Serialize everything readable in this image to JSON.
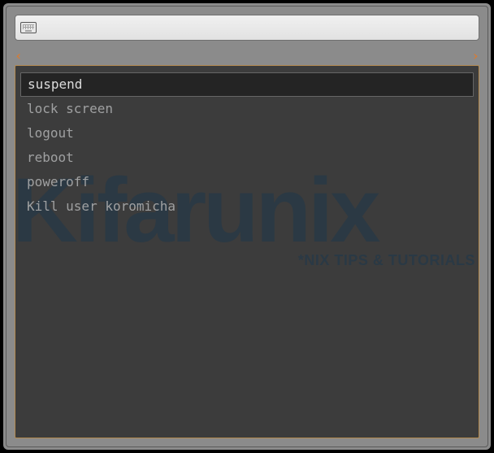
{
  "search": {
    "value": "",
    "placeholder": ""
  },
  "arrows": {
    "left": "‹",
    "right": "›"
  },
  "menu": {
    "items": [
      {
        "label": "suspend",
        "selected": true
      },
      {
        "label": "lock screen",
        "selected": false
      },
      {
        "label": "logout",
        "selected": false
      },
      {
        "label": "reboot",
        "selected": false
      },
      {
        "label": "poweroff",
        "selected": false
      },
      {
        "label": "Kill user koromicha",
        "selected": false
      }
    ]
  },
  "watermark": {
    "main": "Kifarunix",
    "sub": "*NIX TIPS & TUTORIALS"
  },
  "colors": {
    "accent": "#e07a2a",
    "panel": "#3c3c3c",
    "panel_border": "#b38a50",
    "window": "#8b8b8b"
  }
}
